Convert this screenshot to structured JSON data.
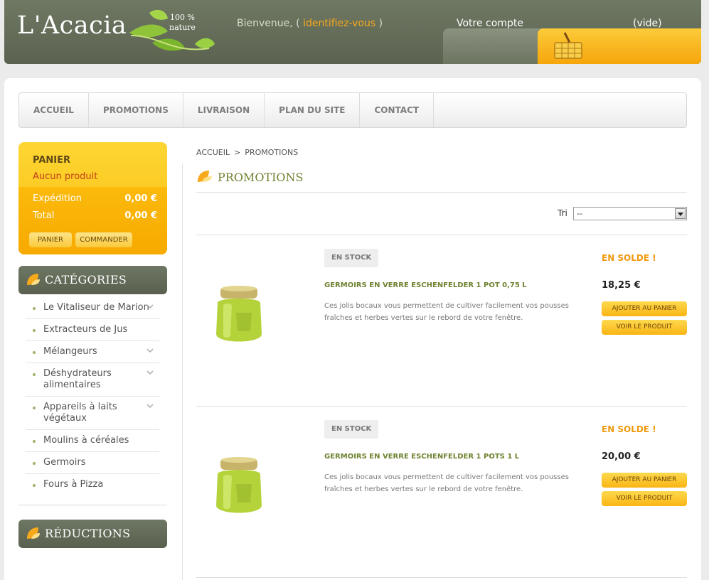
{
  "header": {
    "logo": "L'Acacia",
    "tagline_line1": "100 %",
    "tagline_line2": "nature",
    "welcome_prefix": "Bienvenue, (",
    "login_link": "identifiez-vous",
    "welcome_suffix": ")",
    "account_label": "Votre compte",
    "cart_status": "(vide)"
  },
  "menu": {
    "items": [
      "ACCUEIL",
      "PROMOTIONS",
      "LIVRAISON",
      "PLAN DU SITE",
      "CONTACT"
    ]
  },
  "cart": {
    "title": "PANIER",
    "empty": "Aucun produit",
    "shipping_label": "Expédition",
    "shipping_value": "0,00 €",
    "total_label": "Total",
    "total_value": "0,00 €",
    "cart_button": "PANIER",
    "order_button": "COMMANDER"
  },
  "categories": {
    "title": "CATÉGORIES",
    "items": [
      {
        "label": "Le Vitaliseur de Marion"
      },
      {
        "label": "Extracteurs de Jus"
      },
      {
        "label": "Mélangeurs"
      },
      {
        "label": "Déshydrateurs alimentaires"
      },
      {
        "label": "Appareils à laits végétaux"
      },
      {
        "label": "Moulins à céréales"
      },
      {
        "label": "Germoirs"
      },
      {
        "label": "Fours à Pizza"
      }
    ]
  },
  "reductions": {
    "title": "RÉDUCTIONS"
  },
  "breadcrumb": {
    "home": "ACCUEIL",
    "separator": ">",
    "current": "PROMOTIONS"
  },
  "page": {
    "title": "PROMOTIONS"
  },
  "sort": {
    "label": "Tri",
    "selected": "--"
  },
  "products": [
    {
      "stock": "EN STOCK",
      "name": "GERMOIRS EN VERRE ESCHENFELDER 1 POT 0,75 L",
      "description": "Ces jolis bocaux vous permettent de cultiver facilement vos pousses fraîches et herbes vertes sur le rebord de votre fenêtre.",
      "sale": "EN SOLDE !",
      "price": "18,25 €",
      "add_button": "AJOUTER AU PANIER",
      "view_button": "VOIR LE PRODUIT"
    },
    {
      "stock": "EN STOCK",
      "name": "GERMOIRS EN VERRE ESCHENFELDER 1 POTS 1 L",
      "description": "Ces jolis bocaux vous permettent de cultiver facilement vos pousses fraîches et herbes vertes sur le rebord de votre fenêtre.",
      "sale": "EN SOLDE !",
      "price": "20,00 €",
      "add_button": "AJOUTER AU PANIER",
      "view_button": "VOIR LE PRODUIT"
    }
  ]
}
